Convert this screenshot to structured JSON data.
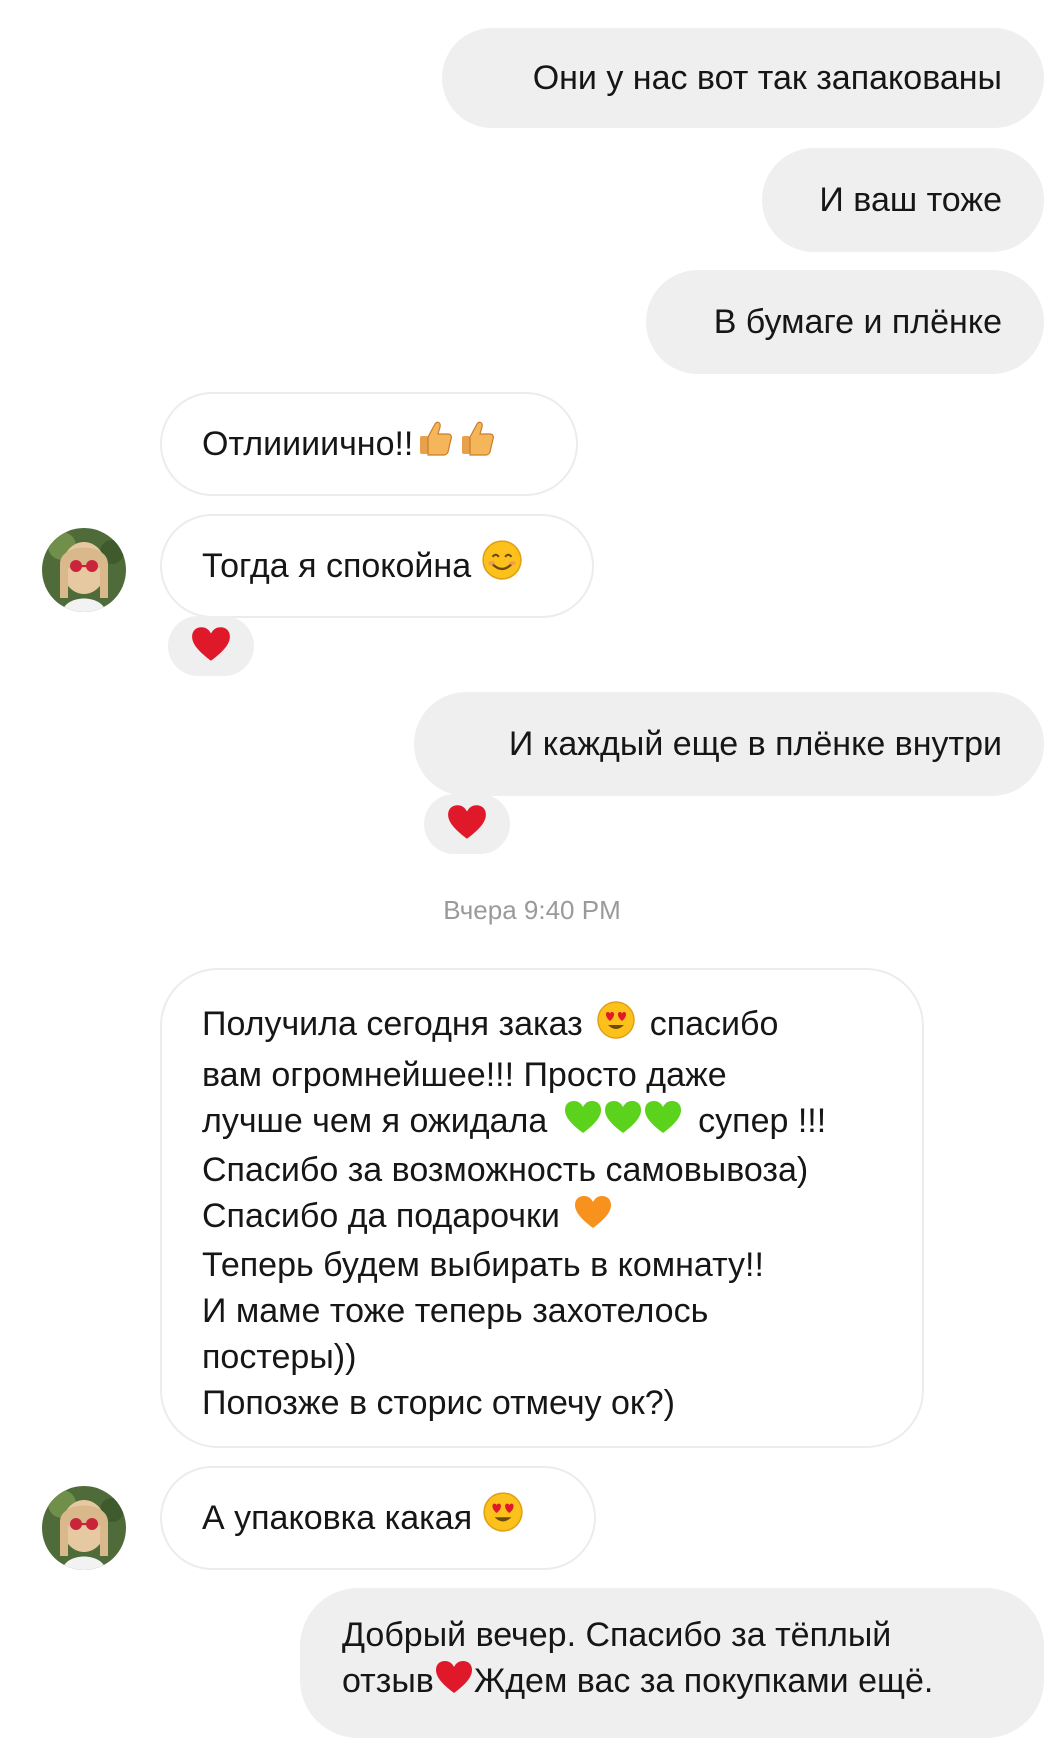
{
  "messages": {
    "m1": "Они у нас вот так запакованы",
    "m2": "И ваш тоже",
    "m3": "В бумаге и плёнке",
    "m4": "Отлиииично!!",
    "m5": "Тогда я спокойна",
    "m6": "И каждый еще в плёнке внутри",
    "m7": {
      "lines": [
        "Получила сегодня заказ",
        "спасибо",
        "вам огромнейшее!!! Просто даже",
        "лучше чем я ожидала",
        "супер !!!",
        "Спасибо за возможность самовывоза)",
        "Спасибо да подарочки",
        "Теперь будем выбирать в комнату!!",
        "И маме тоже теперь захотелось",
        "постеры))",
        "Попозже в сторис отмечу ок?)"
      ]
    },
    "m8": "А упаковка какая",
    "m9": {
      "line1": "Добрый вечер. Спасибо за тёплый",
      "line2a": "отзыв",
      "line2b": "Ждем вас за покупками ещё."
    }
  },
  "timestamp": "Вчера 9:40 PM",
  "icons": {
    "thumbs_up": "thumbs-up-icon",
    "smile": "smiling-face-icon",
    "heart": "red-heart-icon",
    "heart_eyes": "heart-eyes-face-icon",
    "green_heart": "green-heart-icon",
    "orange_heart": "orange-heart-icon"
  },
  "colors": {
    "outgoing_bubble": "#efefef",
    "incoming_border": "#ececec",
    "heart": "#e0192a",
    "green_heart": "#5bd21b",
    "orange_heart": "#f7921e",
    "emoji_yellow": "#fcc21b"
  }
}
